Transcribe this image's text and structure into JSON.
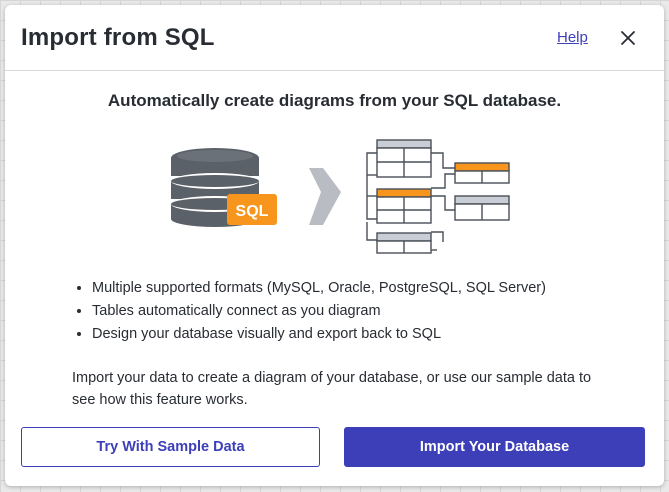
{
  "dialog": {
    "title": "Import from SQL",
    "help_label": "Help",
    "close_icon": "close-icon"
  },
  "body": {
    "headline": "Automatically create diagrams from your SQL database.",
    "illustration": {
      "badge_text": "SQL",
      "icons": [
        "database-icon",
        "arrow-right-icon",
        "schema-diagram-icon"
      ]
    },
    "features": [
      "Multiple supported formats (MySQL, Oracle, PostgreSQL, SQL Server)",
      "Tables automatically connect as you diagram",
      "Design your database visually and export back to SQL"
    ],
    "description": "Import your data to create a diagram of your database, or use our sample data to see how this feature works."
  },
  "footer": {
    "sample_button_label": "Try With Sample Data",
    "import_button_label": "Import Your Database"
  },
  "colors": {
    "accent": "#3d3fb8",
    "sql_badge": "#f7951d",
    "database_body": "#5b6168",
    "arrow": "#b9bdc3",
    "table_header_gray": "#c8cdd6",
    "table_header_orange": "#f7951d",
    "table_outline": "#4a5058"
  }
}
